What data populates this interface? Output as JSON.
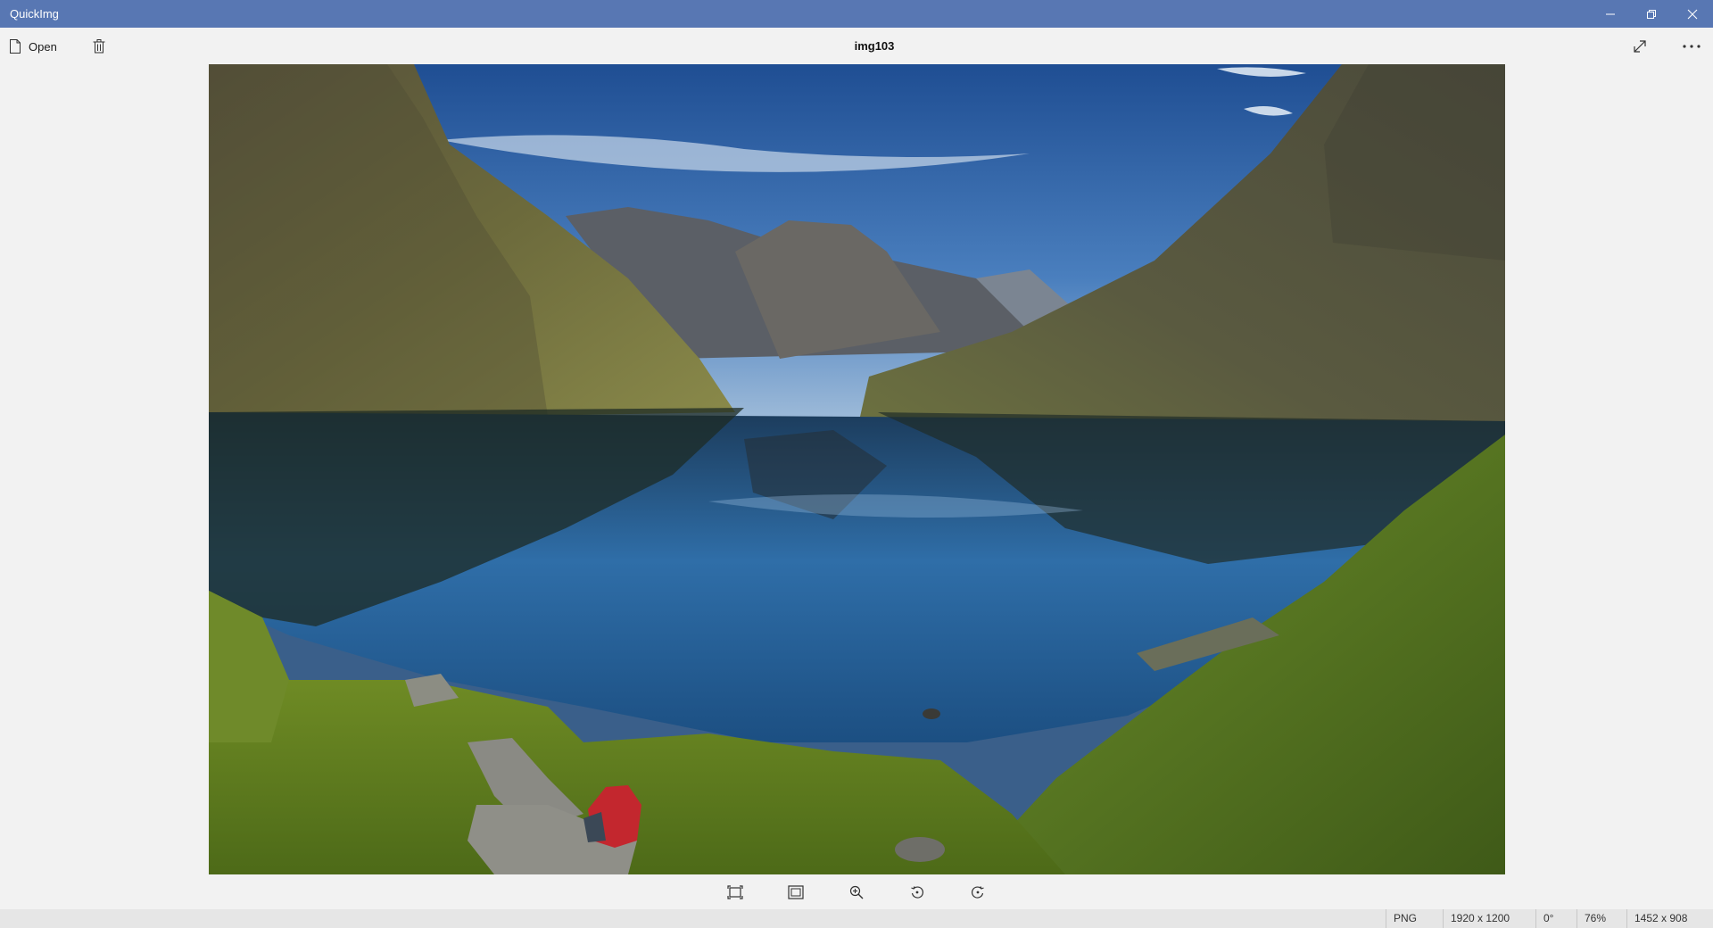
{
  "window": {
    "app_title": "QuickImg",
    "controls": {
      "minimize_icon": "minimize-icon",
      "maximize_icon": "restore-icon",
      "close_icon": "close-icon"
    }
  },
  "toolbar": {
    "open_label": "Open",
    "open_icon": "document-icon",
    "delete_icon": "trash-icon",
    "file_name": "img103",
    "fullscreen_icon": "expand-icon",
    "more_icon": "more-ellipsis-icon"
  },
  "image": {
    "description_icon": "photo-landscape"
  },
  "bottom_controls": [
    {
      "name": "fit-to-window-button",
      "icon": "fit-screen-icon"
    },
    {
      "name": "actual-size-button",
      "icon": "actual-size-icon"
    },
    {
      "name": "zoom-in-button",
      "icon": "zoom-in-icon"
    },
    {
      "name": "rotate-left-button",
      "icon": "rotate-left-icon"
    },
    {
      "name": "rotate-right-button",
      "icon": "rotate-right-icon"
    }
  ],
  "statusbar": {
    "format": "PNG",
    "image_dimensions": "1920 x 1200",
    "rotation": "0°",
    "zoom": "76%",
    "view_dimensions": "1452 x 908"
  },
  "colors": {
    "titlebar": "#5877b3",
    "background": "#f2f2f2",
    "statusbar": "#e6e6e6"
  }
}
